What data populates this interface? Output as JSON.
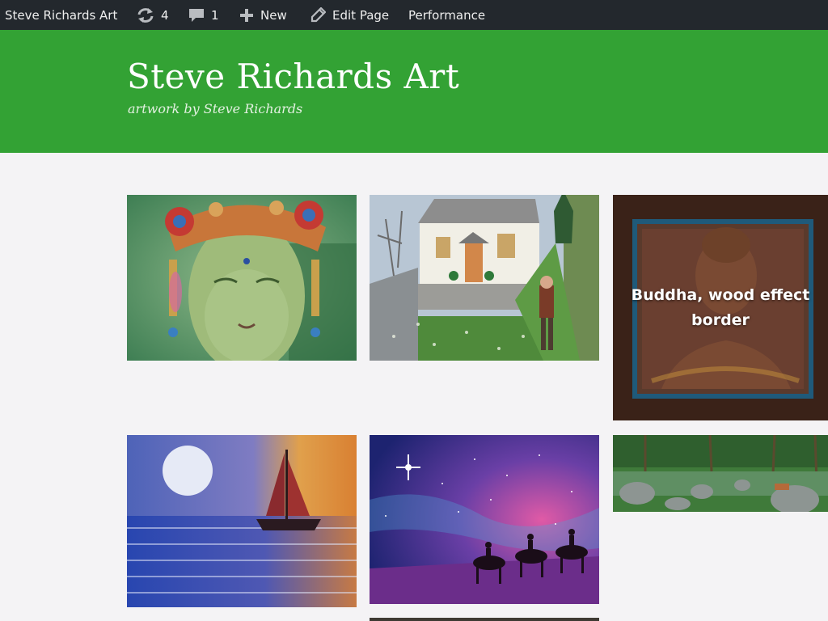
{
  "adminbar": {
    "site_name": "Steve Richards Art",
    "updates_count": "4",
    "comments_count": "1",
    "new_label": "New",
    "edit_label": "Edit Page",
    "performance_label": "Performance"
  },
  "header": {
    "title": "Steve Richards Art",
    "description": "artwork by Steve Richards"
  },
  "gallery": {
    "items": [
      {
        "caption": "",
        "subject": "green tara face painting"
      },
      {
        "caption": "",
        "subject": "white cottage with man painting"
      },
      {
        "caption": "Buddha, wood effect border",
        "subject": "buddha painting with frame"
      },
      {
        "caption": "",
        "subject": "sailboat at moonlit sea painting"
      },
      {
        "caption": "",
        "subject": "three wise men on camels under star painting"
      },
      {
        "caption": "",
        "subject": "forest river with rocks painting"
      }
    ]
  },
  "colors": {
    "adminbar_bg": "#23282d",
    "header_bg": "#33a234",
    "page_bg": "#f4f3f5"
  }
}
